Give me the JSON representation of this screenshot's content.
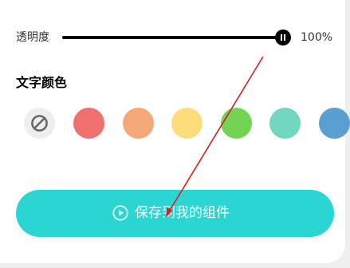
{
  "opacity": {
    "label": "透明度",
    "value_text": "100%",
    "level": 1.0
  },
  "text_color": {
    "title": "文字颜色",
    "swatches": [
      {
        "name": "none",
        "icon": "no-color-icon",
        "color": "#eeeeee"
      },
      {
        "name": "red",
        "color": "#f07070"
      },
      {
        "name": "orange",
        "color": "#f4a877"
      },
      {
        "name": "yellow",
        "color": "#fddd7b"
      },
      {
        "name": "green",
        "color": "#72d354"
      },
      {
        "name": "teal",
        "color": "#72d7c0"
      },
      {
        "name": "blue",
        "color": "#5a9fd2"
      }
    ]
  },
  "save_button": {
    "label": "保存到我的组件",
    "icon": "play-circle-icon",
    "color": "#2bd5d2"
  },
  "annotation": {
    "color": "#d51f1f"
  }
}
